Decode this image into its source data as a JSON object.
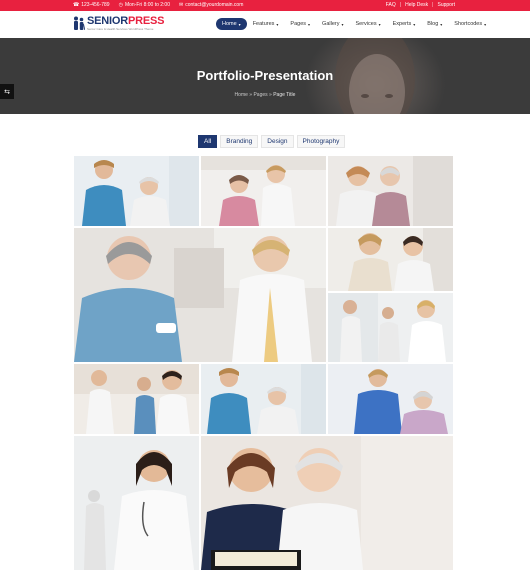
{
  "topbar": {
    "phone": "123-456-789",
    "hours": "Mon-Fri 8:00 to 2:00",
    "email": "contact@yourdomain.com",
    "links": [
      "FAQ",
      "Help Desk",
      "Support"
    ]
  },
  "brand": {
    "name_part1": "SENIOR",
    "name_part2": "PRESS",
    "tagline": "Senior Care & Health Services WordPress Theme"
  },
  "nav": [
    {
      "label": "Home",
      "active": true
    },
    {
      "label": "Features"
    },
    {
      "label": "Pages"
    },
    {
      "label": "Gallery"
    },
    {
      "label": "Services"
    },
    {
      "label": "Experts"
    },
    {
      "label": "Blog"
    },
    {
      "label": "Shortcodes"
    }
  ],
  "hero": {
    "title": "Portfolio-Presentation",
    "breadcrumb": [
      "Home",
      "Pages",
      "Page Title"
    ]
  },
  "filters": [
    "All",
    "Branding",
    "Design",
    "Photography"
  ],
  "colors": {
    "accent_red": "#e8213f",
    "navy": "#1e3770",
    "hero_bg": "#3b3b3b"
  },
  "icons": {
    "phone": "phone-icon",
    "clock": "clock-icon",
    "mail": "envelope-icon",
    "sidebar": "sidebar-toggle-icon"
  }
}
